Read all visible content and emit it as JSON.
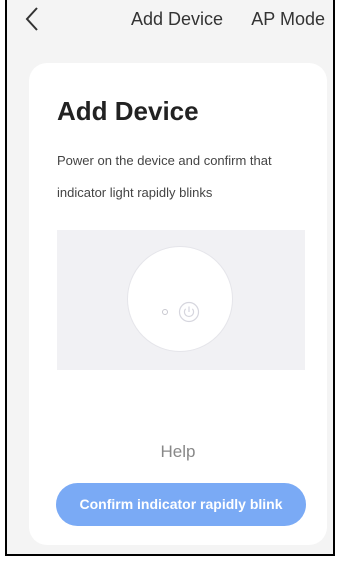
{
  "nav": {
    "back_icon": "chevron-left-icon",
    "title": "Add Device",
    "right_label": "AP Mode"
  },
  "card": {
    "title": "Add Device",
    "description": "Power on the device and confirm that indicator light rapidly blinks",
    "illustration_icons": [
      "indicator-led-icon",
      "power-icon"
    ],
    "help_label": "Help",
    "confirm_label": "Confirm indicator rapidly blink"
  },
  "colors": {
    "screen_background": "#f4f4f4",
    "card_background": "#ffffff",
    "button_background": "#7aaaf5",
    "button_text": "#ffffff",
    "help_text": "#888888"
  }
}
